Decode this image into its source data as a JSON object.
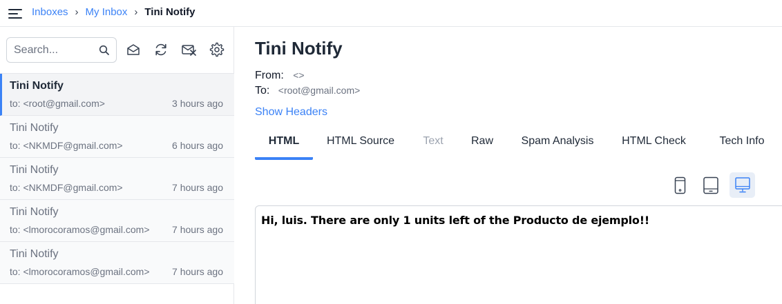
{
  "breadcrumb": {
    "items": [
      "Inboxes",
      "My Inbox"
    ],
    "current": "Tini Notify"
  },
  "search": {
    "placeholder": "Search..."
  },
  "toolbar": {
    "icons": [
      "mark-read-icon",
      "refresh-icon",
      "clear-inbox-icon",
      "settings-icon"
    ]
  },
  "messages": [
    {
      "subject": "Tini Notify",
      "to": "to: <root@gmail.com>",
      "time": "3 hours ago"
    },
    {
      "subject": "Tini Notify",
      "to": "to: <NKMDF@gmail.com>",
      "time": "6 hours ago"
    },
    {
      "subject": "Tini Notify",
      "to": "to: <NKMDF@gmail.com>",
      "time": "7 hours ago"
    },
    {
      "subject": "Tini Notify",
      "to": "to: <lmorocoramos@gmail.com>",
      "time": "7 hours ago"
    },
    {
      "subject": "Tini Notify",
      "to": "to: <lmorocoramos@gmail.com>",
      "time": "7 hours ago"
    }
  ],
  "email": {
    "title": "Tini Notify",
    "from_label": "From:",
    "from_value": "<>",
    "to_label": "To:",
    "to_value": "<root@gmail.com>",
    "show_headers": "Show Headers"
  },
  "tabs": [
    "HTML",
    "HTML Source",
    "Text",
    "Raw",
    "Spam Analysis",
    "HTML Check",
    "Tech Info"
  ],
  "active_tab": "HTML",
  "disabled_tab": "Text",
  "devices": [
    "phone-icon",
    "tablet-icon",
    "desktop-icon"
  ],
  "active_device": "desktop-icon",
  "preview": {
    "body": "Hi, luis. There are only 1 units left of the Producto de ejemplo!!"
  },
  "colors": {
    "accent": "#3b82f6",
    "text": "#1f2937",
    "muted": "#6b7280",
    "border": "#e5e7eb"
  }
}
